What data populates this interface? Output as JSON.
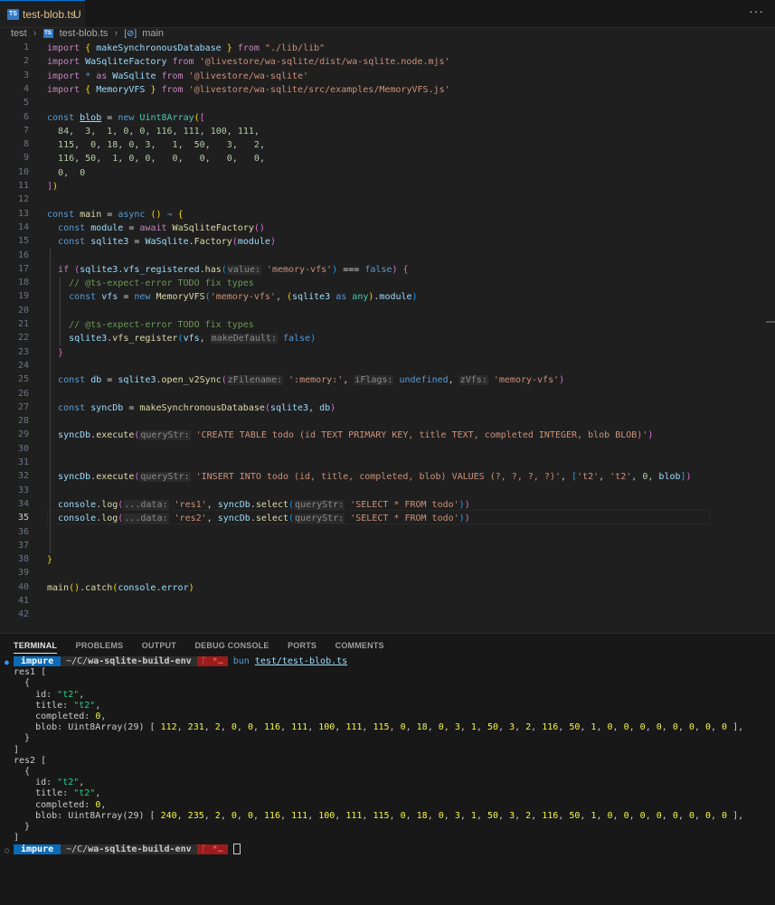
{
  "tab": {
    "filename": "test-blob.ts",
    "status": "U",
    "icon": "typescript-file-icon"
  },
  "tab_actions": {
    "more_label": "···"
  },
  "breadcrumb": {
    "folder": "test",
    "file": "test-blob.ts",
    "symbol": "main"
  },
  "editor": {
    "active_line": 35,
    "line_numbers": [
      "1",
      "2",
      "3",
      "4",
      "5",
      "6",
      "7",
      "8",
      "9",
      "10",
      "11",
      "12",
      "13",
      "14",
      "15",
      "16",
      "17",
      "18",
      "19",
      "20",
      "21",
      "22",
      "23",
      "24",
      "25",
      "26",
      "27",
      "28",
      "29",
      "30",
      "31",
      "32",
      "33",
      "34",
      "35",
      "36",
      "37",
      "38",
      "39",
      "40",
      "41",
      "42"
    ],
    "lines": [
      "import { makeSynchronousDatabase } from \"./lib/lib\"",
      "import WaSqliteFactory from '@livestore/wa-sqlite/dist/wa-sqlite.node.mjs'",
      "import * as WaSqlite from '@livestore/wa-sqlite'",
      "import { MemoryVFS } from '@livestore/wa-sqlite/src/examples/MemoryVFS.js'",
      "",
      "const blob = new Uint8Array([",
      "  84,  3,  1, 0, 0, 116, 111, 100, 111,",
      "  115,  0, 18, 0, 3,   1,  50,   3,   2,",
      "  116, 50,  1, 0, 0,   0,   0,   0,   0,",
      "  0,  0",
      "])",
      "",
      "const main = async () => {",
      "  const module = await WaSqliteFactory()",
      "  const sqlite3 = WaSqlite.Factory(module)",
      "",
      "  if (sqlite3.vfs_registered.has(value: 'memory-vfs') === false) {",
      "    // @ts-expect-error TODO fix types",
      "    const vfs = new MemoryVFS('memory-vfs', (sqlite3 as any).module)",
      "",
      "    // @ts-expect-error TODO fix types",
      "    sqlite3.vfs_register(vfs, makeDefault: false)",
      "  }",
      "",
      "  const db = sqlite3.open_v2Sync(zFilename: ':memory:', iFlags: undefined, zVfs: 'memory-vfs')",
      "",
      "  const syncDb = makeSynchronousDatabase(sqlite3, db)",
      "",
      "  syncDb.execute(queryStr: 'CREATE TABLE todo (id TEXT PRIMARY KEY, title TEXT, completed INTEGER, blob BLOB)')",
      "",
      "",
      "  syncDb.execute(queryStr: 'INSERT INTO todo (id, title, completed, blob) VALUES (?, ?, ?, ?)', ['t2', 't2', 0, blob])",
      "",
      "  console.log(...data: 'res1', syncDb.select(queryStr: 'SELECT * FROM todo'))",
      "  console.log(...data: 'res2', syncDb.select(queryStr: 'SELECT * FROM todo'))",
      "",
      "",
      "}",
      "",
      "main().catch(console.error)",
      "",
      ""
    ]
  },
  "panel": {
    "tabs": [
      "TERMINAL",
      "PROBLEMS",
      "OUTPUT",
      "DEBUG CONSOLE",
      "PORTS",
      "COMMENTS"
    ],
    "active_tab": "TERMINAL"
  },
  "terminal": {
    "prompt": {
      "env": "impure",
      "cwd_prefix": "~/C/",
      "cwd": "wa-sqlite-build-env",
      "git": "ᚴ *…"
    },
    "command": {
      "program": "bun",
      "arg": "test/test-blob.ts"
    },
    "output_lines": [
      "res1 [",
      "  {",
      "    id: \"t2\",",
      "    title: \"t2\",",
      "    completed: 0,",
      "    blob: Uint8Array(29) [ 112, 231, 2, 0, 0, 116, 111, 100, 111, 115, 0, 18, 0, 3, 1, 50, 3, 2, 116, 50, 1, 0, 0, 0, 0, 0, 0, 0, 0 ],",
      "  }",
      "]",
      "res2 [",
      "  {",
      "    id: \"t2\",",
      "    title: \"t2\",",
      "    completed: 0,",
      "    blob: Uint8Array(29) [ 240, 235, 2, 0, 0, 116, 111, 100, 111, 115, 0, 18, 0, 3, 1, 50, 3, 2, 116, 50, 1, 0, 0, 0, 0, 0, 0, 0, 0 ],",
      "  }",
      "]"
    ]
  },
  "colors": {
    "editor_bg": "#1f1f1f",
    "panel_bg": "#181818",
    "accent": "#0078d4",
    "prompt_env_bg": "#0a6bb8",
    "git_segment_bg": "#9b1c1c"
  }
}
